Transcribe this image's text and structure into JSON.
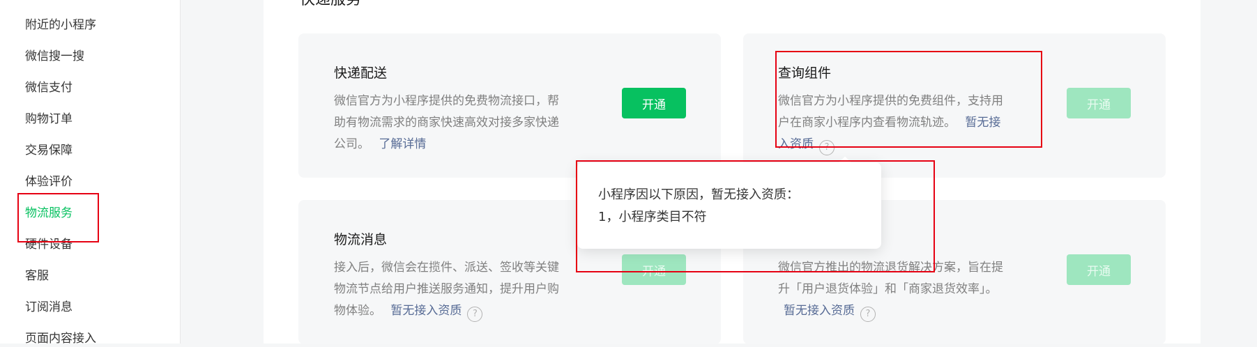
{
  "sidebar": {
    "items": [
      {
        "label": "附近的小程序"
      },
      {
        "label": "微信搜一搜"
      },
      {
        "label": "微信支付"
      },
      {
        "label": "购物订单"
      },
      {
        "label": "交易保障"
      },
      {
        "label": "体验评价"
      },
      {
        "label": "物流服务",
        "active": true
      },
      {
        "label": "硬件设备"
      },
      {
        "label": "客服"
      },
      {
        "label": "订阅消息"
      },
      {
        "label": "页面内容接入"
      }
    ]
  },
  "main": {
    "section_title": "快递服务",
    "cards": [
      {
        "title": "快递配送",
        "desc": "微信官方为小程序提供的免费物流接口，帮助有物流需求的商家快速高效对接多家快递公司。",
        "link": "了解详情",
        "button": "开通",
        "button_state": "enabled"
      },
      {
        "title": "查询组件",
        "desc": "微信官方为小程序提供的免费组件，支持用户在商家小程序内查看物流轨迹。",
        "link": "暂无接入资质",
        "help_icon": "question-circle-icon",
        "button": "开通",
        "button_state": "disabled"
      },
      {
        "title": "物流消息",
        "desc": "接入后，微信会在揽件、派送、签收等关键物流节点给用户推送服务通知，提升用户购物体验。",
        "link": "暂无接入资质",
        "help_icon": "question-circle-icon",
        "button": "开通",
        "button_state": "disabled"
      },
      {
        "title": "",
        "desc": "微信官方推出的物流退货解决方案，旨在提升「用户退货体验」和「商家退货效率」。",
        "link": "暂无接入资质",
        "help_icon": "question-circle-icon",
        "button": "开通",
        "button_state": "disabled"
      }
    ]
  },
  "tooltip": {
    "line1": "小程序因以下原因，暂无接入资质：",
    "line2": "1，小程序类目不符"
  },
  "colors": {
    "accent": "#07c160",
    "accent_disabled": "#9ee6bf",
    "link": "#576b95",
    "annotation_box": "#e60012"
  }
}
